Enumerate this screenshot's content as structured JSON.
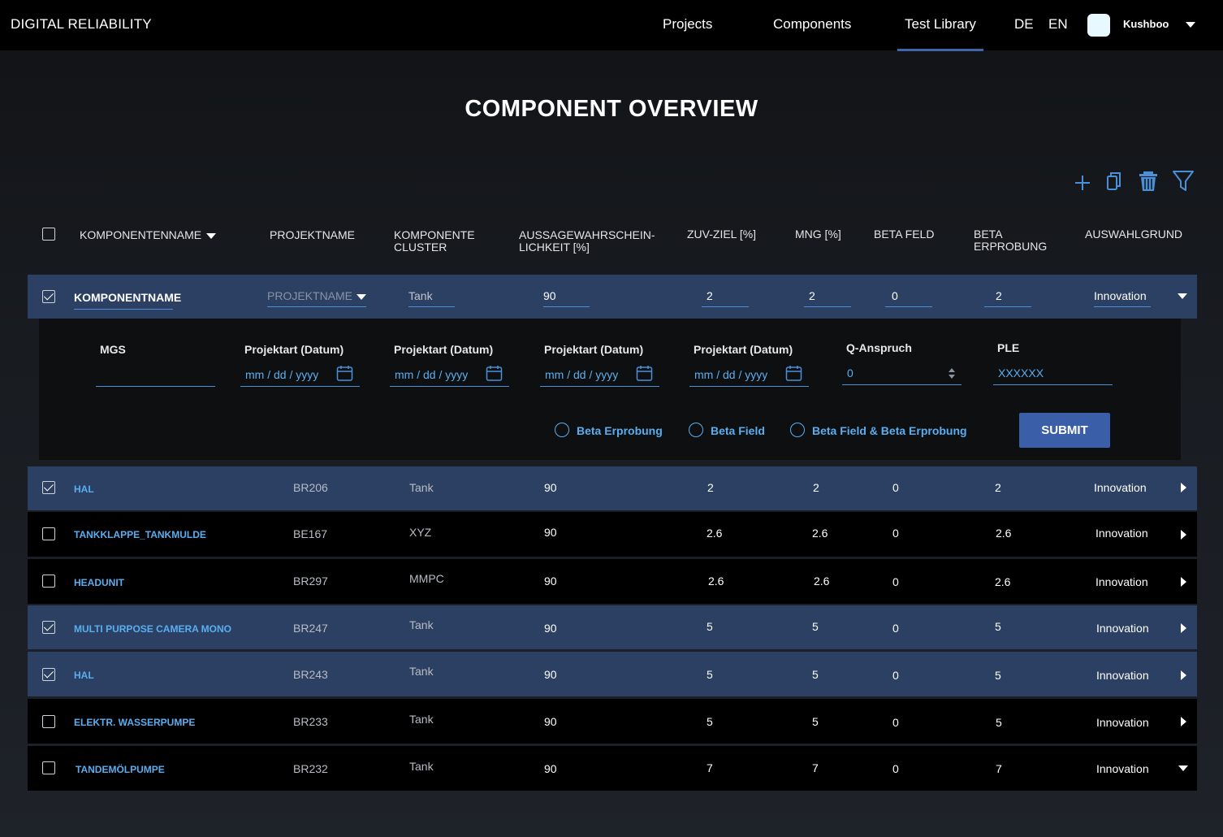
{
  "app": {
    "brand": "DIGITAL RELIABILITY"
  },
  "nav": {
    "projects": "Projects",
    "components": "Components",
    "test_library": "Test Library",
    "active": "Test Library"
  },
  "lang": {
    "de": "DE",
    "en": "EN"
  },
  "user": {
    "name": "Kushboo"
  },
  "page": {
    "title": "COMPONENT OVERVIEW"
  },
  "toolbar": {
    "icons": [
      "plus-icon",
      "copy-icon",
      "trash-icon",
      "filter-icon"
    ],
    "accent": "#4a90d9"
  },
  "columns": [
    "KOMPONENTENNAME",
    "PROJEKTNAME",
    "KOMPONENTE CLUSTER",
    "AUSSAGEWAHRSCHEIN-LICHKEIT [%]",
    "ZUV-ZIEL [%]",
    "MNG [%]",
    "BETA FELD",
    "BETA ERPROBUNG",
    "AUSWAHLGRUND"
  ],
  "column_parts": {
    "cluster": [
      "KOMPONENTE",
      "CLUSTER"
    ],
    "aussage": [
      "AUSSAGEWAHRSCHEIN-",
      "LICHKEIT [%]"
    ],
    "beta_erprobung": [
      "BETA",
      "ERPROBUNG"
    ]
  },
  "edit_row": {
    "name": "KOMPONENTNAME",
    "project_placeholder": "PROJEKTNAME",
    "cluster": "Tank",
    "aussage": "90",
    "zuv": "2",
    "mng": "2",
    "beta_feld": "0",
    "beta_erprobung": "2",
    "auswahlgrund": "Innovation"
  },
  "edit_panel": {
    "mgs_label": "MGS",
    "mgs_value": "",
    "date_fields": [
      {
        "label": "Projektart (Datum)",
        "placeholder": "mm / dd / yyyy"
      },
      {
        "label": "Projektart (Datum)",
        "placeholder": "mm / dd / yyyy"
      },
      {
        "label": "Projektart (Datum)",
        "placeholder": "mm / dd / yyyy"
      },
      {
        "label": "Projektart (Datum)",
        "placeholder": "mm / dd / yyyy"
      }
    ],
    "q_anspruch_label": "Q-Anspruch",
    "q_anspruch_value": "0",
    "ple_label": "PLE",
    "ple_value": "XXXXXX",
    "radios": [
      "Beta Erprobung",
      "Beta Field",
      "Beta Field & Beta Erprobung"
    ],
    "submit": "SUBMIT"
  },
  "rows": [
    {
      "checked": true,
      "name": "HAL",
      "project": "BR206",
      "cluster": "Tank",
      "aussage": "90",
      "zuv": "2",
      "mng": "2",
      "beta_feld": "0",
      "beta_erprobung": "2",
      "auswahlgrund": "Innovation",
      "expanded": false
    },
    {
      "checked": false,
      "name": "TANKKLAPPE_TANKMULDE",
      "project": "BE167",
      "cluster": "XYZ",
      "aussage": "90",
      "zuv": "2.6",
      "mng": "2.6",
      "beta_feld": "0",
      "beta_erprobung": "2.6",
      "auswahlgrund": "Innovation",
      "expanded": false
    },
    {
      "checked": false,
      "name": "HEADUNIT",
      "project": "BR297",
      "cluster": "MMPC",
      "aussage": "90",
      "zuv": "2.6",
      "mng": "2.6",
      "beta_feld": "0",
      "beta_erprobung": "2.6",
      "auswahlgrund": "Innovation",
      "expanded": false
    },
    {
      "checked": true,
      "name": "MULTI PURPOSE CAMERA MONO",
      "project": "BR247",
      "cluster": "Tank",
      "aussage": "90",
      "zuv": "5",
      "mng": "5",
      "beta_feld": "0",
      "beta_erprobung": "5",
      "auswahlgrund": "Innovation",
      "expanded": false
    },
    {
      "checked": true,
      "name": "HAL",
      "project": "BR243",
      "cluster": "Tank",
      "aussage": "90",
      "zuv": "5",
      "mng": "5",
      "beta_feld": "0",
      "beta_erprobung": "5",
      "auswahlgrund": "Innovation",
      "expanded": false
    },
    {
      "checked": false,
      "name": "ELEKTR. WASSERPUMPE",
      "project": "BR233",
      "cluster": "Tank",
      "aussage": "90",
      "zuv": "5",
      "mng": "5",
      "beta_feld": "0",
      "beta_erprobung": "5",
      "auswahlgrund": "Innovation",
      "expanded": false
    },
    {
      "checked": false,
      "name": "TANDEMÖLPUMPE",
      "project": "BR232",
      "cluster": "Tank",
      "aussage": "90",
      "zuv": "7",
      "mng": "7",
      "beta_feld": "0",
      "beta_erprobung": "7",
      "auswahlgrund": "Innovation",
      "expanded": true
    }
  ],
  "colors": {
    "selected_row": "#2c4064",
    "accent_blue": "#5aaef0",
    "submit": "#3a5fa8",
    "nav_active": "#3f66a8"
  }
}
